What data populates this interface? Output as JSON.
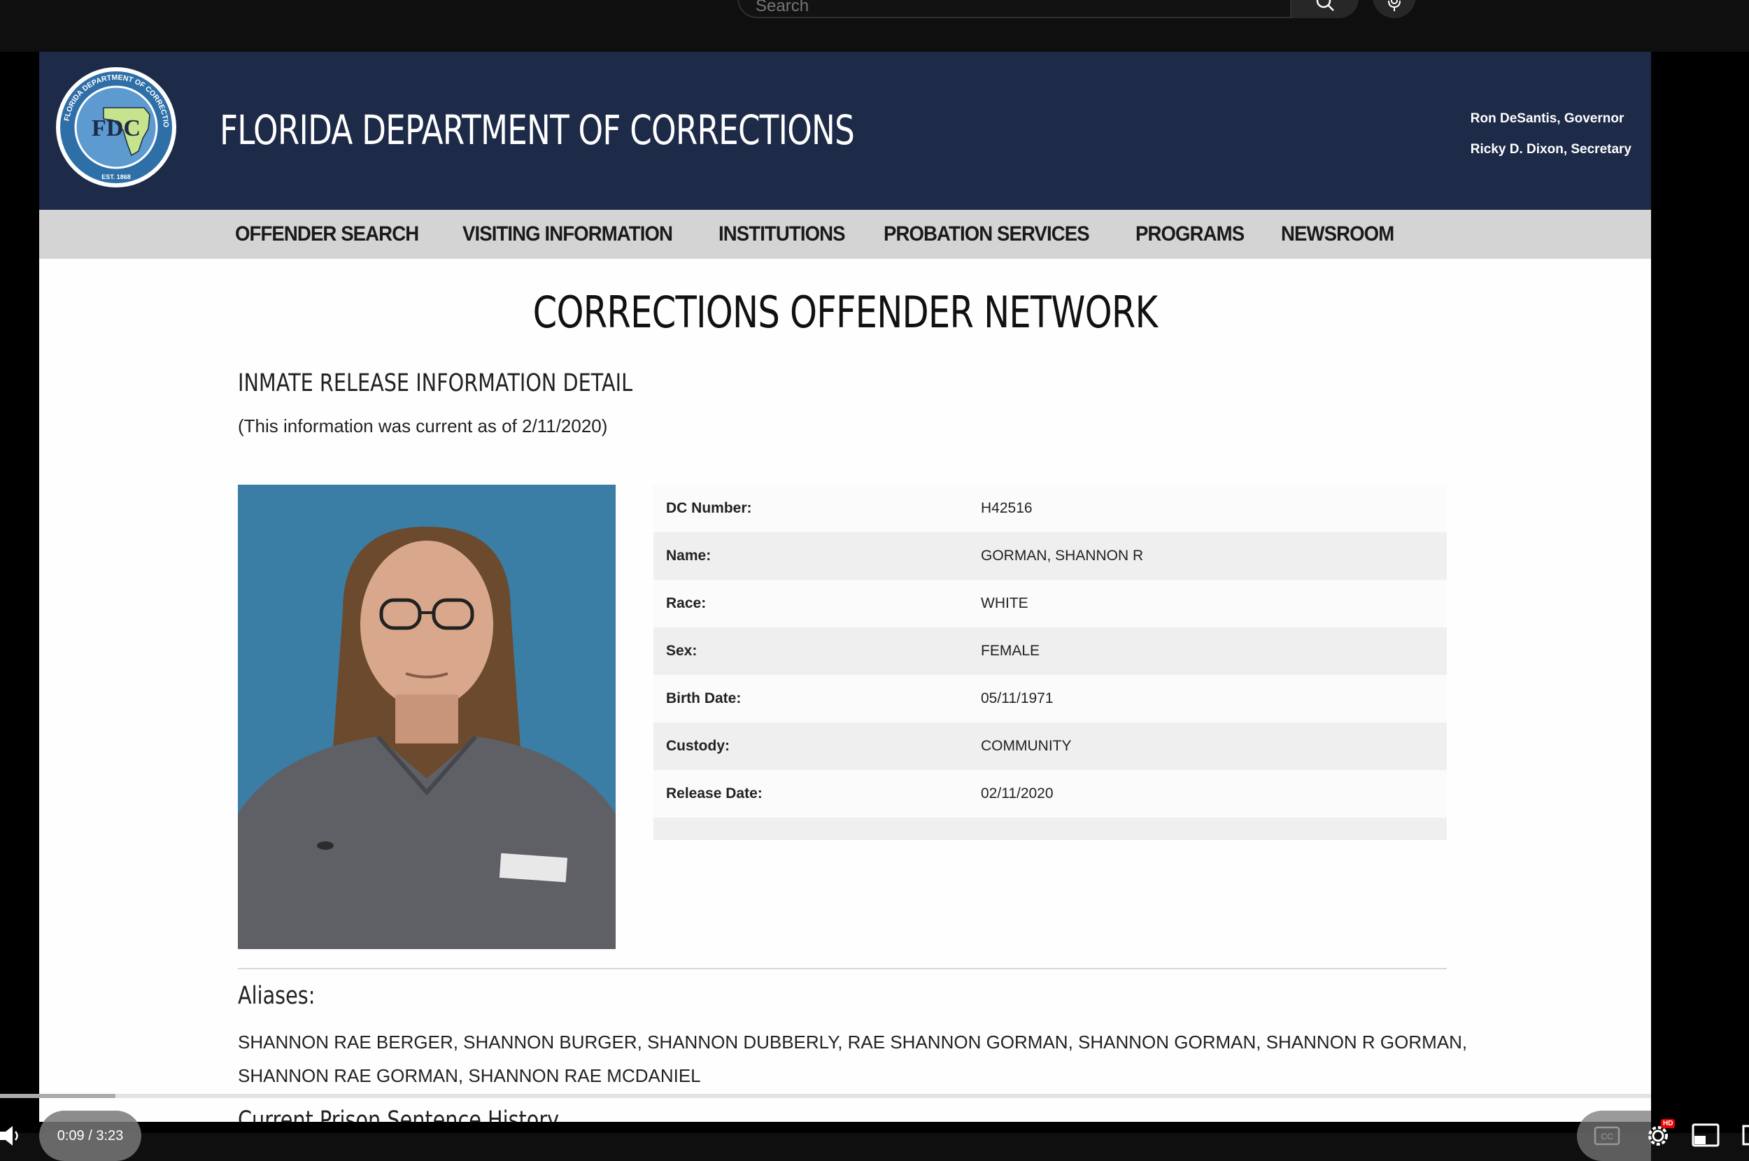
{
  "youtube": {
    "search_placeholder": "Search",
    "time": "0:09 / 3:23",
    "progress_fraction": 0.07,
    "hd_badge": "HD"
  },
  "site": {
    "title": "FLORIDA DEPARTMENT OF CORRECTIONS",
    "seal": {
      "ring_text": "FLORIDA DEPARTMENT OF CORRECTIONS",
      "initials": "FDC",
      "established": "EST. 1868"
    },
    "officials": [
      "Ron DeSantis, Governor",
      "Ricky D. Dixon, Secretary"
    ],
    "nav": [
      "OFFENDER SEARCH",
      "VISITING INFORMATION",
      "INSTITUTIONS",
      "PROBATION SERVICES",
      "PROGRAMS",
      "NEWSROOM"
    ]
  },
  "content": {
    "page_heading": "CORRECTIONS OFFENDER NETWORK",
    "section_heading": "INMATE RELEASE INFORMATION DETAIL",
    "current_note": "(This information was current as of 2/11/2020)",
    "details": [
      {
        "label": "DC Number:",
        "value": "H42516"
      },
      {
        "label": "Name:",
        "value": "GORMAN, SHANNON R"
      },
      {
        "label": "Race:",
        "value": "WHITE"
      },
      {
        "label": "Sex:",
        "value": "FEMALE"
      },
      {
        "label": "Birth Date:",
        "value": "05/11/1971"
      },
      {
        "label": "Custody:",
        "value": "COMMUNITY"
      },
      {
        "label": "Release Date:",
        "value": "02/11/2020"
      }
    ],
    "aliases_heading": "Aliases:",
    "aliases_text": "SHANNON RAE BERGER, SHANNON BURGER, SHANNON DUBBERLY, RAE SHANNON GORMAN, SHANNON GORMAN, SHANNON R GORMAN, SHANNON RAE GORMAN, SHANNON RAE MCDANIEL",
    "next_heading": "Current Prison Sentence History"
  },
  "colors": {
    "header_bg": "#1d2a48",
    "nav_bg": "#d4d4d4",
    "seal_blue": "#2f6fa8",
    "photo_bg": "#3f84ad"
  }
}
